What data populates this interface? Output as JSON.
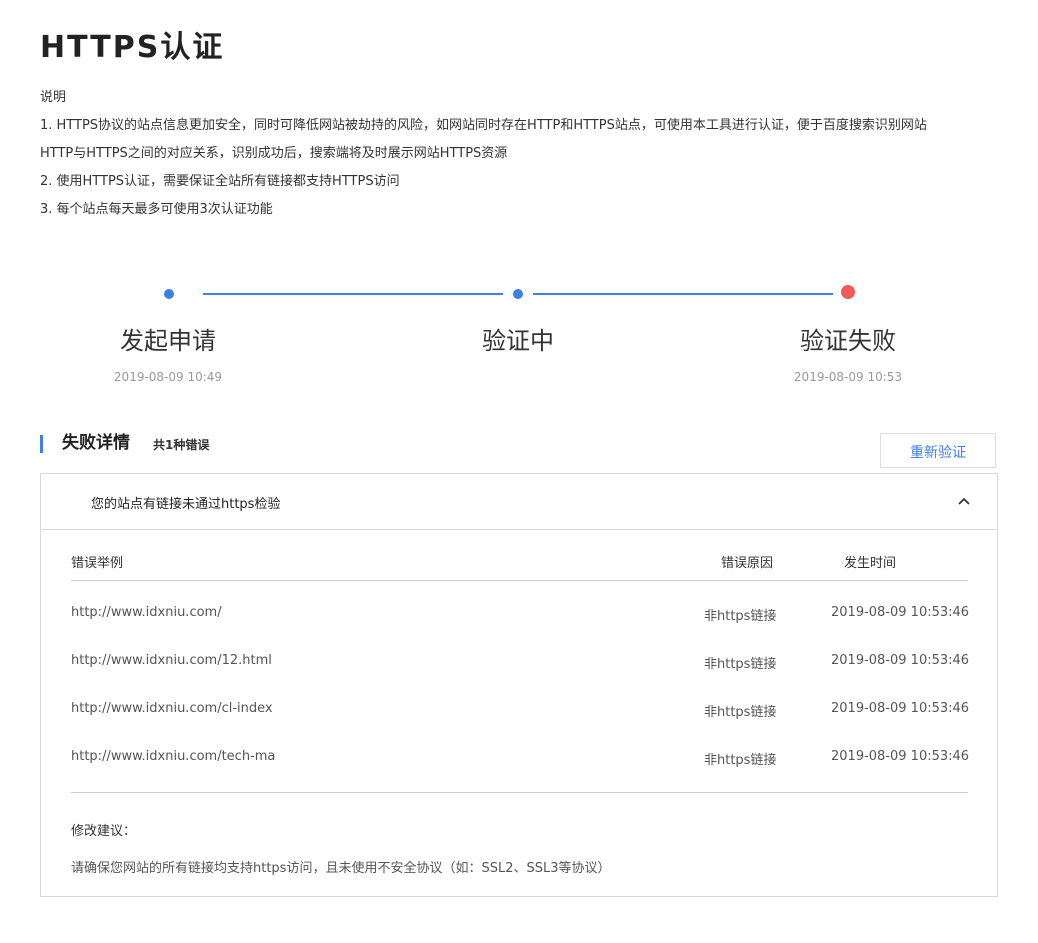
{
  "title": "HTTPS认证",
  "description": {
    "heading": "说明",
    "lines": [
      "1. HTTPS协议的站点信息更加安全，同时可降低网站被劫持的风险，如网站同时存在HTTP和HTTPS站点，可使用本工具进行认证，便于百度搜索识别网站",
      "HTTP与HTTPS之间的对应关系，识别成功后，搜索端将及时展示网站HTTPS资源",
      "2. 使用HTTPS认证，需要保证全站所有链接都支持HTTPS访问",
      "3. 每个站点每天最多可使用3次认证功能"
    ]
  },
  "steps": [
    {
      "label": "发起申请",
      "time": "2019-08-09 10:49",
      "status": "done"
    },
    {
      "label": "验证中",
      "time": "",
      "status": "done"
    },
    {
      "label": "验证失败",
      "time": "2019-08-09 10:53",
      "status": "failed"
    }
  ],
  "colors": {
    "accent": "#3d7ee8",
    "fail": "#f05a5a"
  },
  "failure": {
    "title": "失败详情",
    "count_text": "共1种错误",
    "retry_label": "重新验证",
    "panel_title": "您的站点有链接未通过https检验",
    "table": {
      "headers": [
        "错误举例",
        "错误原因",
        "发生时间"
      ],
      "rows": [
        {
          "url": "http://www.idxniu.com/",
          "reason": "非https链接",
          "time": "2019-08-09 10:53:46"
        },
        {
          "url": "http://www.idxniu.com/12.html",
          "reason": "非https链接",
          "time": "2019-08-09 10:53:46"
        },
        {
          "url": "http://www.idxniu.com/cl-index",
          "reason": "非https链接",
          "time": "2019-08-09 10:53:46"
        },
        {
          "url": "http://www.idxniu.com/tech-ma",
          "reason": "非https链接",
          "time": "2019-08-09 10:53:46"
        }
      ]
    },
    "suggestion_title": "修改建议：",
    "suggestion_text": "请确保您网站的所有链接均支持https访问，且未使用不安全协议（如：SSL2、SSL3等协议）"
  }
}
